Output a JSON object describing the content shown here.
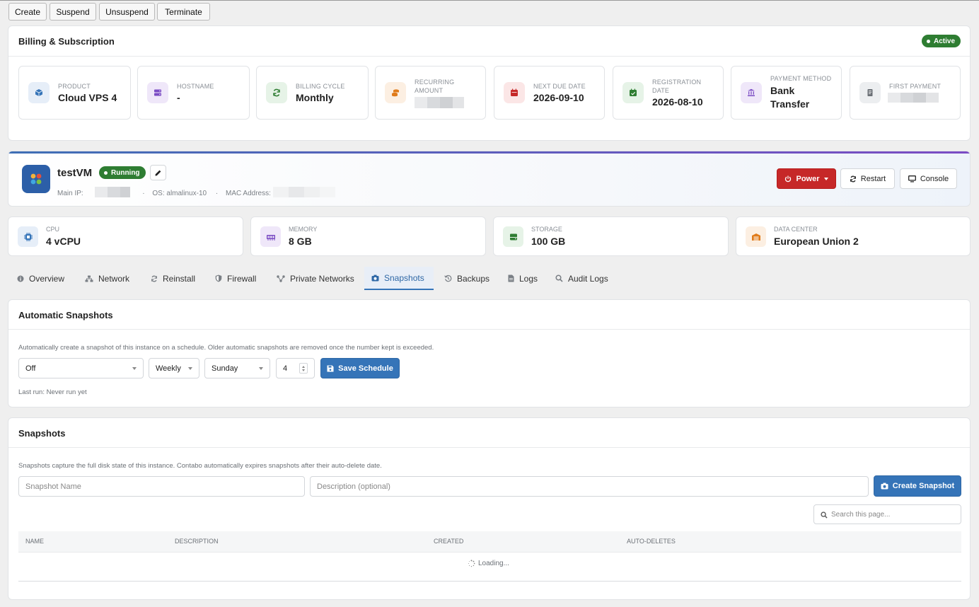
{
  "toolbar": {
    "buttons": [
      "Create",
      "Suspend",
      "Unsuspend",
      "Terminate"
    ]
  },
  "billing": {
    "title": "Billing & Subscription",
    "status": "Active",
    "items": [
      {
        "label": "Product",
        "value": "Cloud VPS 4",
        "icon": "cube-icon",
        "color": "#3574b8"
      },
      {
        "label": "Hostname",
        "value": "-",
        "icon": "server-icon",
        "color": "#7b4cc4"
      },
      {
        "label": "Billing Cycle",
        "value": "Monthly",
        "icon": "refresh-icon",
        "color": "#2e7d32"
      },
      {
        "label": "Recurring",
        "label2": "Amount",
        "value": "",
        "icon": "coins-icon",
        "color": "#e07b1a"
      },
      {
        "label": "Next Due Date",
        "value": "2026-09-10",
        "icon": "calendar-icon",
        "color": "#c62828"
      },
      {
        "label": "Registration",
        "label2": "Date",
        "value": "2026-08-10",
        "icon": "calendar-check-icon",
        "color": "#2e7d32"
      },
      {
        "label": "Payment Method",
        "value": "Bank",
        "value2": "Transfer",
        "icon": "bank-icon",
        "color": "#7b4cc4"
      },
      {
        "label": "First Payment",
        "value": "",
        "icon": "receipt-icon",
        "color": "#6b7076"
      }
    ]
  },
  "vm": {
    "name": "testVM",
    "status": "Running",
    "main_ip_label": "Main IP:",
    "sep1": "·",
    "os": "OS: almalinux-10",
    "sep2": "·",
    "mac_label": "MAC Address:",
    "actions": {
      "power": "Power",
      "restart": "Restart",
      "console": "Console"
    }
  },
  "resources": [
    {
      "label": "CPU",
      "value": "4 vCPU",
      "icon": "cpu-icon",
      "color": "#3574b8"
    },
    {
      "label": "Memory",
      "value": "8 GB",
      "icon": "memory-icon",
      "color": "#7b4cc4"
    },
    {
      "label": "Storage",
      "value": "100 GB",
      "icon": "storage-icon",
      "color": "#2e7d32"
    },
    {
      "label": "Data Center",
      "value": "European Union 2",
      "icon": "warehouse-icon",
      "color": "#e07b1a"
    }
  ],
  "tabs": [
    {
      "label": "Overview",
      "icon": "info-icon"
    },
    {
      "label": "Network",
      "icon": "network-icon"
    },
    {
      "label": "Reinstall",
      "icon": "reinstall-icon"
    },
    {
      "label": "Firewall",
      "icon": "shield-icon"
    },
    {
      "label": "Private Networks",
      "icon": "share-icon"
    },
    {
      "label": "Snapshots",
      "icon": "camera-icon",
      "active": true
    },
    {
      "label": "Backups",
      "icon": "history-icon"
    },
    {
      "label": "Logs",
      "icon": "file-icon"
    },
    {
      "label": "Audit Logs",
      "icon": "search-icon"
    }
  ],
  "auto_snapshots": {
    "title": "Automatic Snapshots",
    "description": "Automatically create a snapshot of this instance on a schedule. Older automatic snapshots are removed once the number kept is exceeded.",
    "mode": "Off",
    "frequency": "Weekly",
    "day": "Sunday",
    "keep": "4",
    "save_label": "Save Schedule",
    "last_run": "Last run: Never run yet"
  },
  "snapshots": {
    "title": "Snapshots",
    "description": "Snapshots capture the full disk state of this instance. Contabo automatically expires snapshots after their auto-delete date.",
    "name_placeholder": "Snapshot Name",
    "desc_placeholder": "Description (optional)",
    "create_label": "Create Snapshot",
    "search_placeholder": "Search this page...",
    "columns": [
      "Name",
      "Description",
      "Created",
      "Auto-Deletes"
    ],
    "loading": "Loading..."
  }
}
